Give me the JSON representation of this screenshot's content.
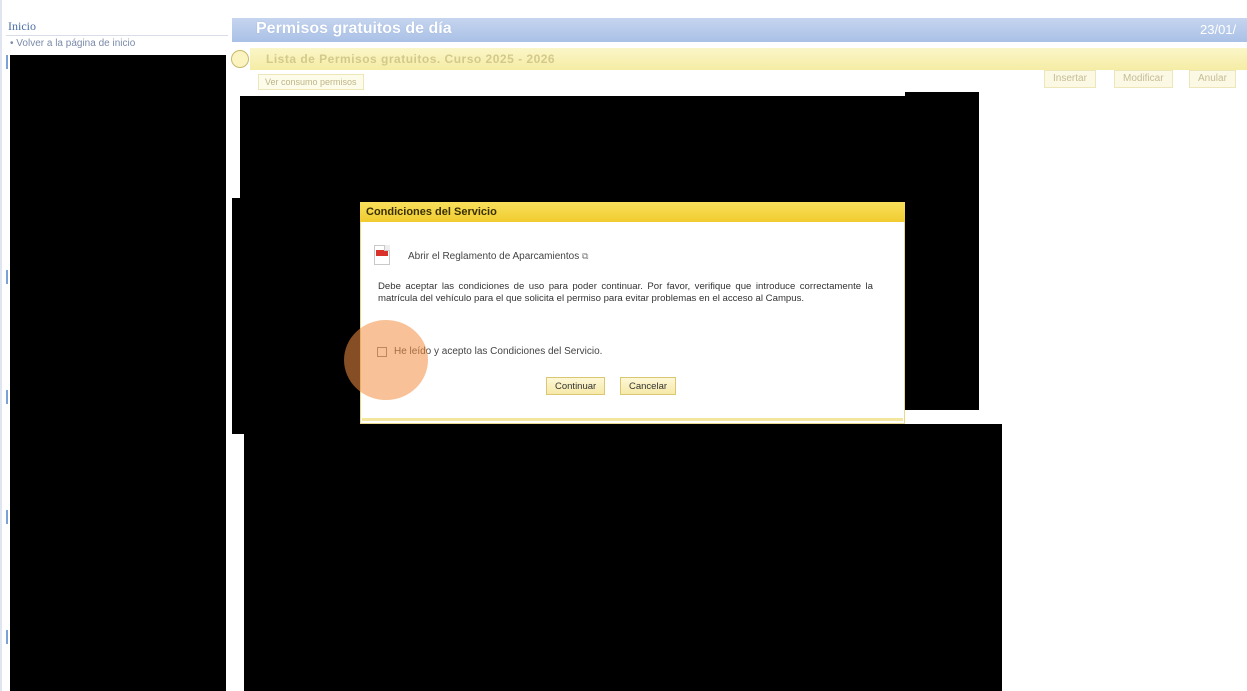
{
  "sidebar": {
    "header": "Inicio",
    "home_link": "Volver a la página de inicio"
  },
  "header": {
    "page_title": "Permisos gratuitos de día",
    "date": "23/01/"
  },
  "list": {
    "title": "Lista de Permisos gratuitos. Curso 2025 - 2026",
    "view_consumption": "Ver consumo permisos",
    "actions": [
      "Insertar",
      "Modificar",
      "Anular"
    ]
  },
  "modal": {
    "title": "Condiciones del Servicio",
    "regulation_link": "Abrir el Reglamento de Aparcamientos",
    "conditions_text": "Debe aceptar las condiciones de uso para poder continuar. Por favor, verifique que introduce correctamente la matrícula del vehículo para el que solicita el permiso para evitar problemas en el acceso al Campus.",
    "accept_label": "He leído y acepto las Condiciones del Servicio.",
    "accept_checked": false,
    "continue_label": "Continuar",
    "cancel_label": "Cancelar"
  },
  "colors": {
    "header_blue": "#a9c0e6",
    "title_yellow": "#f5eca4",
    "modal_header": "#f1cc2f",
    "click_marker": "#f38e42"
  },
  "icons": [
    "pdf-icon",
    "external-link-icon",
    "list-icon",
    "bullet-icon"
  ]
}
